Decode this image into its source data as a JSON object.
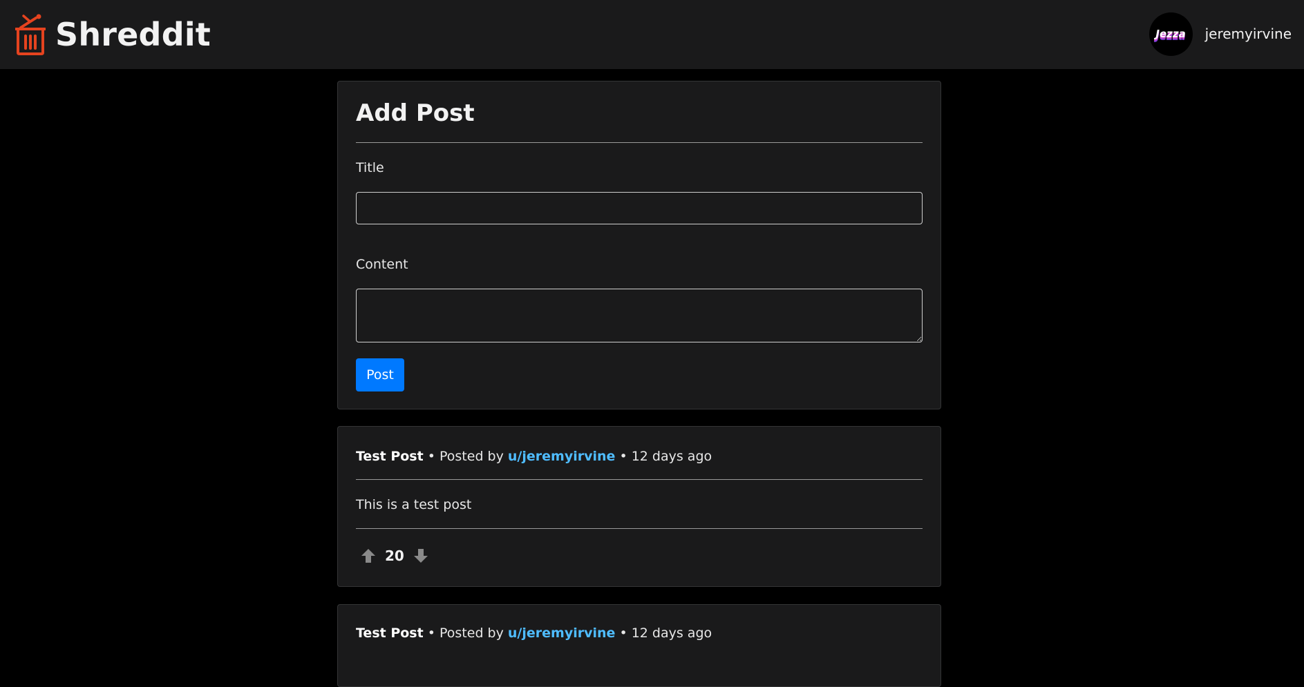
{
  "header": {
    "brand_name": "Shreddit",
    "logo_icon": "shredder-icon",
    "brand_color": "#e5431f",
    "username": "jeremyirvine",
    "avatar_text": "Jezza"
  },
  "add_post": {
    "title": "Add Post",
    "title_label": "Title",
    "title_value": "",
    "content_label": "Content",
    "content_value": "",
    "submit_label": "Post",
    "accent_color": "#0079ff"
  },
  "posts": [
    {
      "title": "Test Post",
      "posted_by_prefix": "• Posted by",
      "author": "u/jeremyirvine",
      "time": "• 12 days ago",
      "body": "This is a test post",
      "votes": "20"
    },
    {
      "title": "Test Post",
      "posted_by_prefix": "• Posted by",
      "author": "u/jeremyirvine",
      "time": "• 12 days ago"
    }
  ]
}
